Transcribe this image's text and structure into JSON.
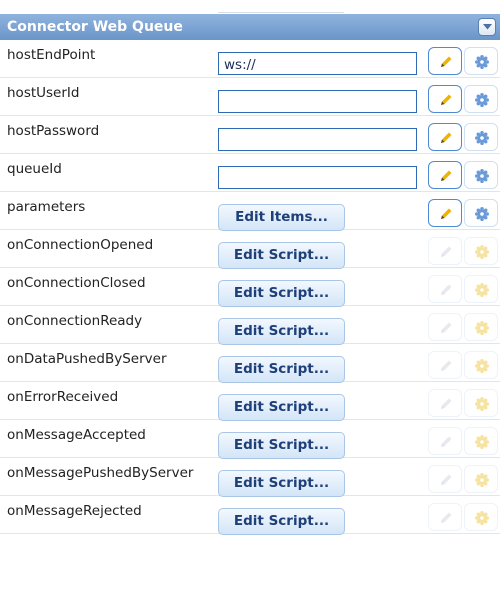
{
  "panel": {
    "title": "Connector Web Queue"
  },
  "properties": [
    {
      "name": "hostEndPoint",
      "kind": "text",
      "value": "ws://",
      "enabled": true
    },
    {
      "name": "hostUserId",
      "kind": "text",
      "value": "",
      "enabled": true
    },
    {
      "name": "hostPassword",
      "kind": "text",
      "value": "",
      "enabled": true
    },
    {
      "name": "queueId",
      "kind": "text",
      "value": "",
      "enabled": true
    },
    {
      "name": "parameters",
      "kind": "button",
      "button_label": "Edit Items...",
      "enabled": true
    },
    {
      "name": "onConnectionOpened",
      "kind": "button",
      "button_label": "Edit Script...",
      "enabled": false
    },
    {
      "name": "onConnectionClosed",
      "kind": "button",
      "button_label": "Edit Script...",
      "enabled": false
    },
    {
      "name": "onConnectionReady",
      "kind": "button",
      "button_label": "Edit Script...",
      "enabled": false
    },
    {
      "name": "onDataPushedByServer",
      "kind": "button",
      "button_label": "Edit Script...",
      "enabled": false
    },
    {
      "name": "onErrorReceived",
      "kind": "button",
      "button_label": "Edit Script...",
      "enabled": false
    },
    {
      "name": "onMessageAccepted",
      "kind": "button",
      "button_label": "Edit Script...",
      "enabled": false
    },
    {
      "name": "onMessagePushedByServer",
      "kind": "button",
      "button_label": "Edit Script...",
      "enabled": false
    },
    {
      "name": "onMessageRejected",
      "kind": "button",
      "button_label": "Edit Script...",
      "enabled": false
    }
  ],
  "icons": {
    "collapse": "chevron-down-icon",
    "edit": "pencil-icon",
    "settings": "gear-icon"
  },
  "colors": {
    "header_bg": "#7aa3d4",
    "pencil_enabled": "#f0b400",
    "gear_enabled": "#6a9bd8",
    "icon_disabled": "#e6e9ef",
    "gear_disabled": "#f6e3a0"
  }
}
